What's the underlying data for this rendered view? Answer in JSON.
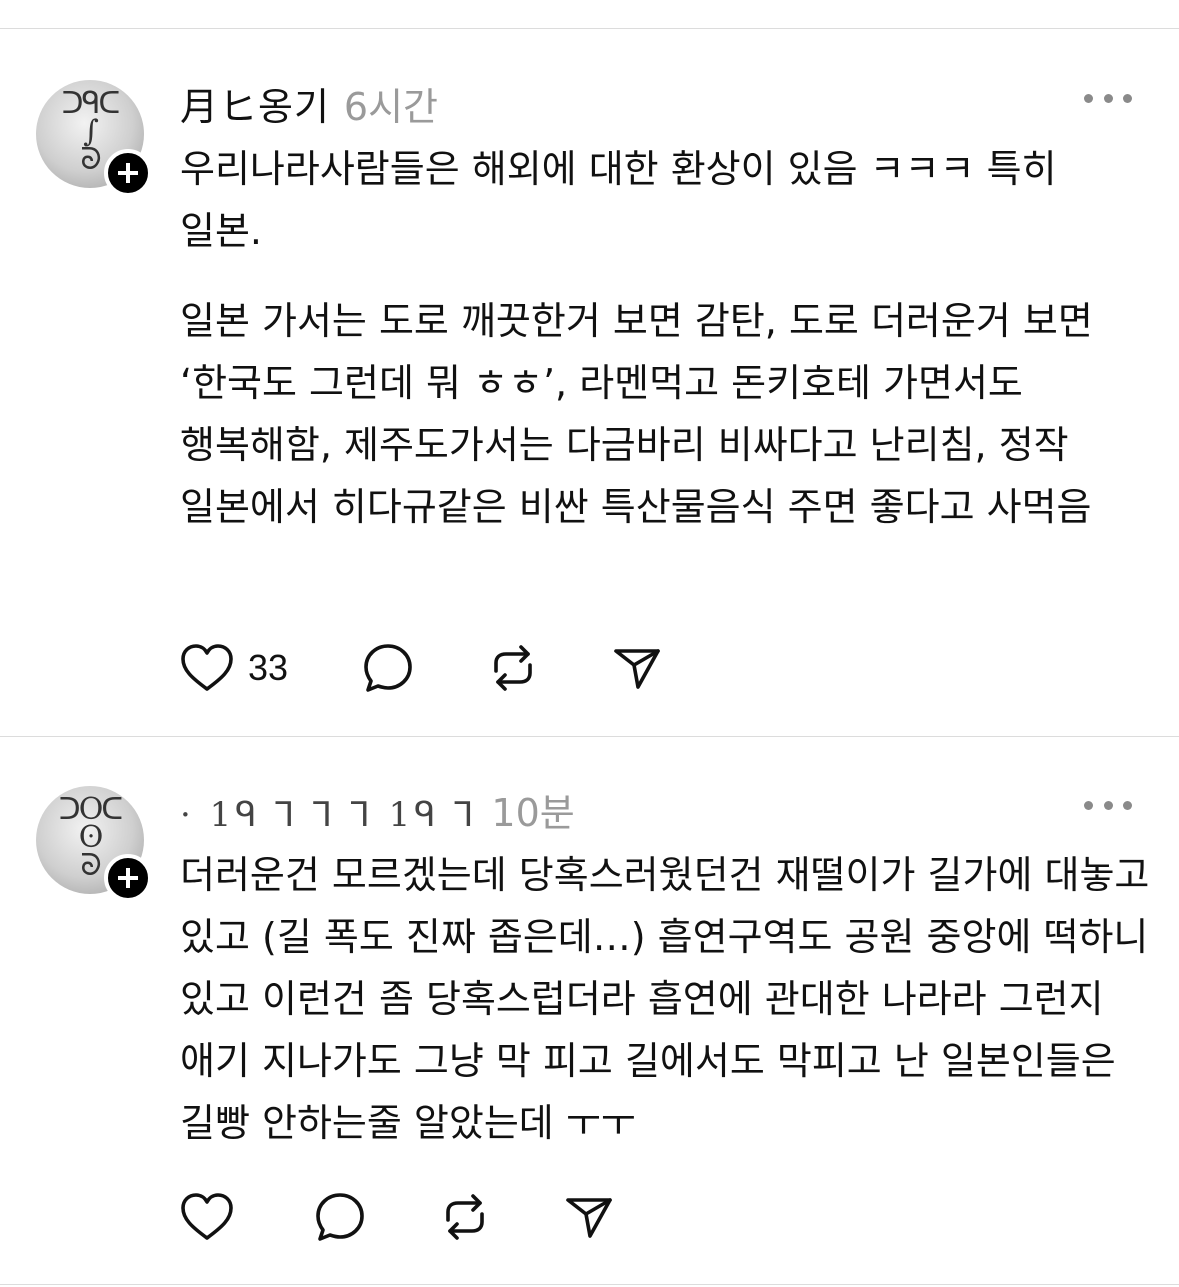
{
  "posts": [
    {
      "username": "月ヒ옹기",
      "time": "6시간",
      "avatar_icon": "profile-avatar",
      "paragraphs": [
        "우리나라사람들은 해외에 대한 환상이 있음 ㅋㅋㅋ 특히 일본.",
        "일본 가서는 도로 깨끗한거 보면 감탄, 도로 더러운거 보면 ‘한국도 그런데 뭐 ㅎㅎ’, 라멘먹고 돈키호테 가면서도 행복해함, 제주도가서는 다금바리 비싸다고 난리침, 정작 일본에서 히다규같은 비싼 특산물음식 주면 좋다고 사먹음"
      ],
      "like_count": "33"
    },
    {
      "username": "·  1ᑫ ⅂ ⅂ ⅂ 1ᑫ ⅂",
      "time": "10분",
      "avatar_icon": "profile-avatar",
      "paragraphs": [
        "더러운건 모르겠는데 당혹스러웠던건 재떨이가 길가에 대놓고 있고 (길 폭도 진짜 좁은데…) 흡연구역도 공원 중앙에 떡하니 있고 이런건 좀 당혹스럽더라 흡연에 관대한 나라라 그런지 애기 지나가도 그냥 막 피고 길에서도 막피고 난 일본인들은 길빵 안하는줄 알았는데 ㅜㅜ"
      ],
      "like_count": ""
    }
  ],
  "icons": {
    "like": "heart-icon",
    "reply": "speech-bubble-icon",
    "repost": "repost-icon",
    "share": "send-icon",
    "more": "more-dots-icon",
    "follow": "plus-icon"
  },
  "colors": {
    "text": "#111111",
    "muted": "#9a9a9a",
    "divider": "#dcdcdc",
    "badge": "#000000"
  }
}
